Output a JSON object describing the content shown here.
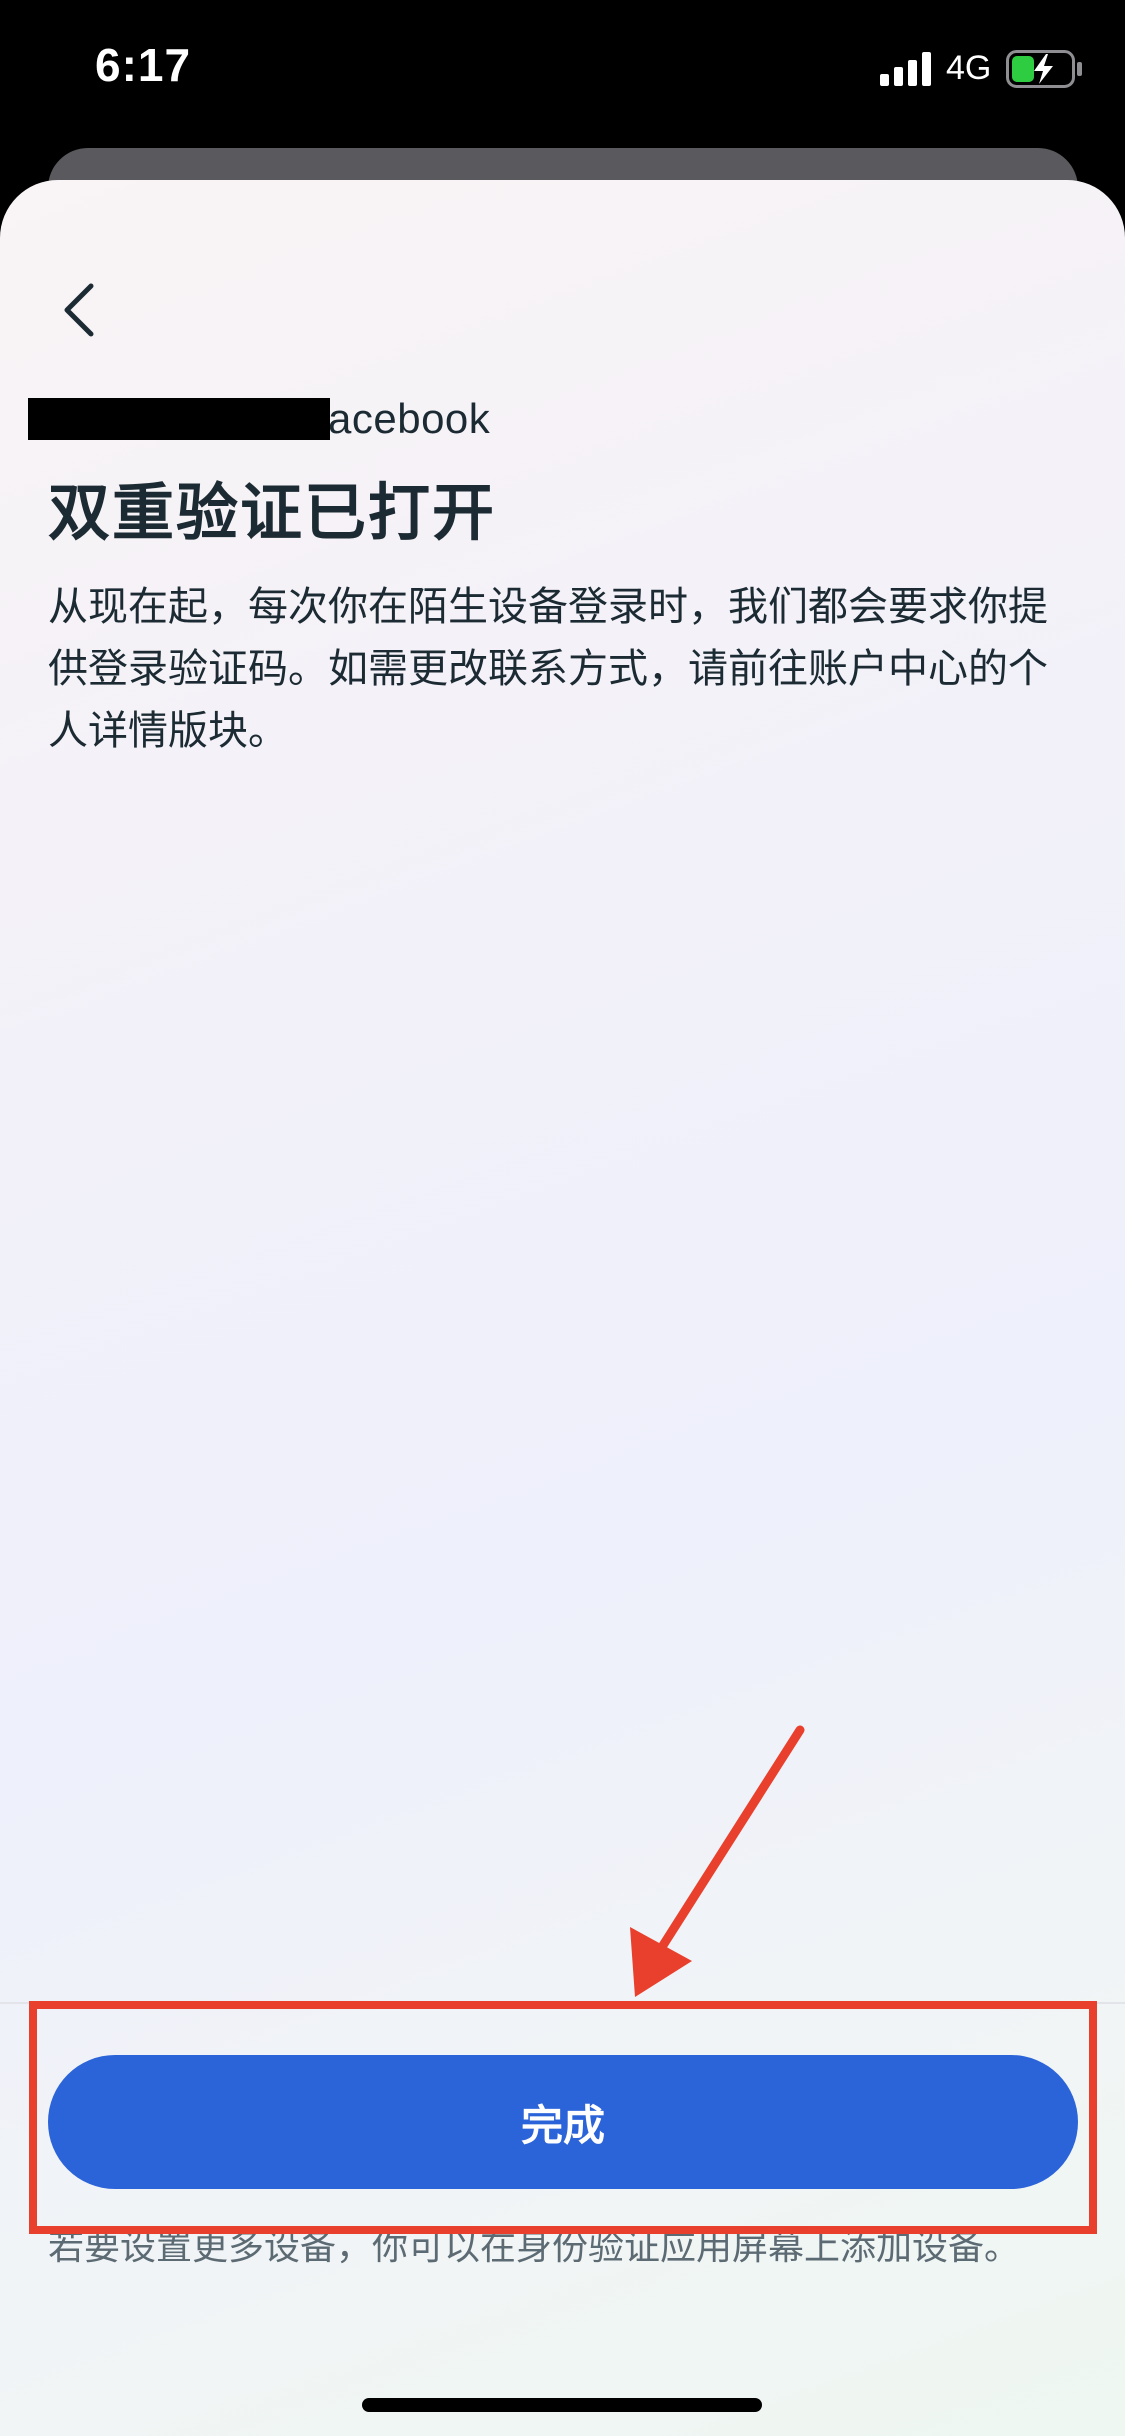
{
  "status_bar": {
    "time": "6:17",
    "network": "4G",
    "battery_color": "#2ecc40"
  },
  "header": {
    "back_icon": "chevron-left-icon",
    "account_label": "acebook"
  },
  "main": {
    "title": "双重验证已打开",
    "description": "从现在起，每次你在陌生设备登录时，我们都会要求你提供登录验证码。如需更改联系方式，请前往账户中心的个人详情版块。"
  },
  "footer": {
    "done_label": "完成",
    "footnote": "若要设置更多设备，你可以在身份验证应用屏幕上添加设备。"
  },
  "colors": {
    "primary_button": "#2b63d9",
    "annotation": "#e8402c",
    "text": "#1c2b33"
  }
}
